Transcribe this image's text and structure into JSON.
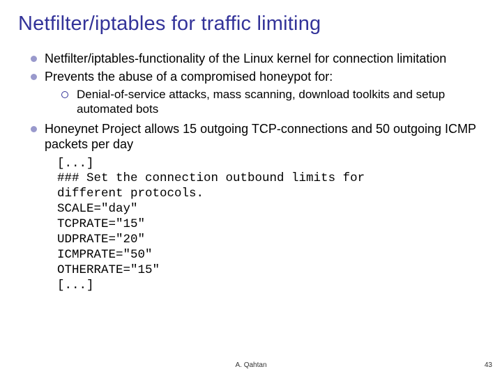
{
  "title": "Netfilter/iptables for traffic limiting",
  "bullets": {
    "b1": "Netfilter/iptables-functionality of the Linux kernel for connection limitation",
    "b2": "Prevents the abuse of a compromised honeypot for:",
    "b2sub": "Denial-of-service attacks, mass scanning, download toolkits and setup automated bots",
    "b3": "Honeynet Project allows 15 outgoing TCP-connections and 50 outgoing ICMP packets per day"
  },
  "code": "[...]\n### Set the connection outbound limits for\ndifferent protocols.\nSCALE=\"day\"\nTCPRATE=\"15\"\nUDPRATE=\"20\"\nICMPRATE=\"50\"\nOTHERRATE=\"15\"\n[...]",
  "footer": {
    "author": "A. Qahtan",
    "page": "43"
  }
}
